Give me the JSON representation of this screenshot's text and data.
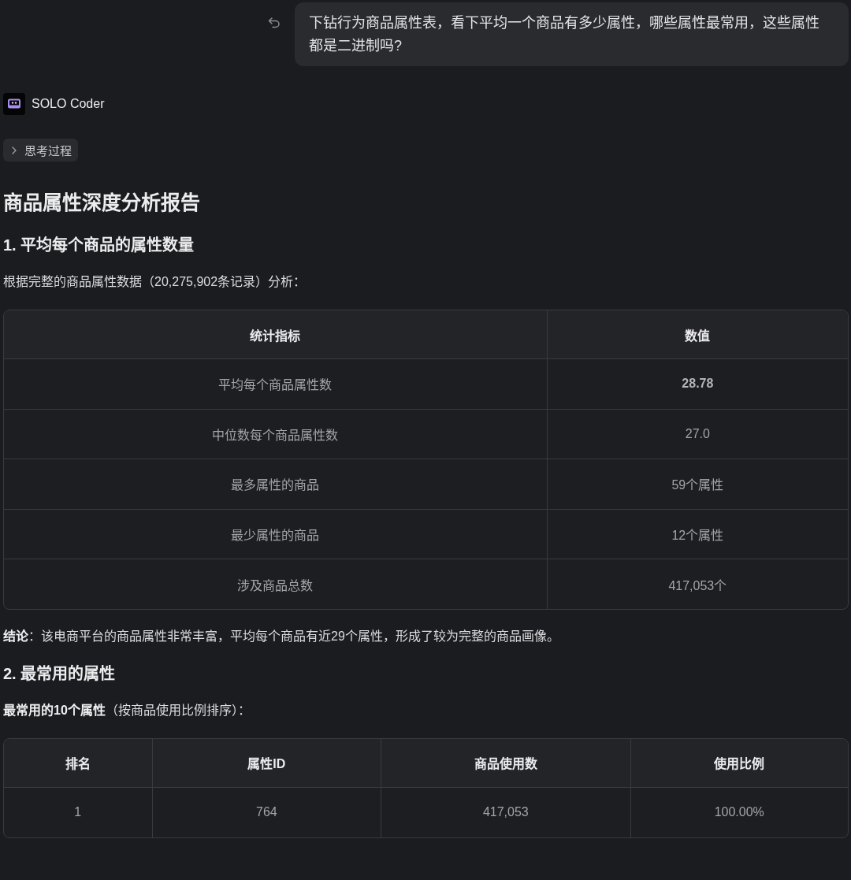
{
  "user_message": {
    "text": "下钻行为商品属性表，看下平均一个商品有多少属性，哪些属性最常用，这些属性都是二进制吗?"
  },
  "agent": {
    "name": "SOLO Coder"
  },
  "thinking_toggle": {
    "label": "思考过程",
    "expanded": false
  },
  "report": {
    "title": "商品属性深度分析报告",
    "sections": [
      {
        "heading": "1. 平均每个商品的属性数量",
        "blocks": [
          {
            "kind": "paragraph",
            "text": "根据完整的商品属性数据（20,275,902条记录）分析："
          },
          {
            "kind": "table",
            "columns": [
              "统计指标",
              "数值"
            ],
            "rows": [
              {
                "cells": [
                  {
                    "text": "平均每个商品属性数",
                    "bold": false
                  },
                  {
                    "text": "28.78",
                    "bold": true
                  }
                ]
              },
              {
                "cells": [
                  {
                    "text": "中位数每个商品属性数",
                    "bold": false
                  },
                  {
                    "text": "27.0",
                    "bold": false
                  }
                ]
              },
              {
                "cells": [
                  {
                    "text": "最多属性的商品",
                    "bold": false
                  },
                  {
                    "text": "59个属性",
                    "bold": false
                  }
                ]
              },
              {
                "cells": [
                  {
                    "text": "最少属性的商品",
                    "bold": false
                  },
                  {
                    "text": "12个属性",
                    "bold": false
                  }
                ]
              },
              {
                "cells": [
                  {
                    "text": "涉及商品总数",
                    "bold": false
                  },
                  {
                    "text": "417,053个",
                    "bold": false
                  }
                ]
              }
            ]
          },
          {
            "kind": "paragraph",
            "text": "**结论**：该电商平台的商品属性非常丰富，平均每个商品有近29个属性，形成了较为完整的商品画像。"
          }
        ]
      },
      {
        "heading": "2. 最常用的属性",
        "blocks": [
          {
            "kind": "paragraph",
            "text": "**最常用的10个属性**（按商品使用比例排序）："
          },
          {
            "kind": "table",
            "columns": [
              "排名",
              "属性ID",
              "商品使用数",
              "使用比例"
            ],
            "rows": [
              {
                "cells": [
                  {
                    "text": "1",
                    "bold": false
                  },
                  {
                    "text": "764",
                    "bold": false
                  },
                  {
                    "text": "417,053",
                    "bold": false
                  },
                  {
                    "text": "100.00%",
                    "bold": false
                  }
                ]
              }
            ]
          }
        ]
      }
    ]
  }
}
